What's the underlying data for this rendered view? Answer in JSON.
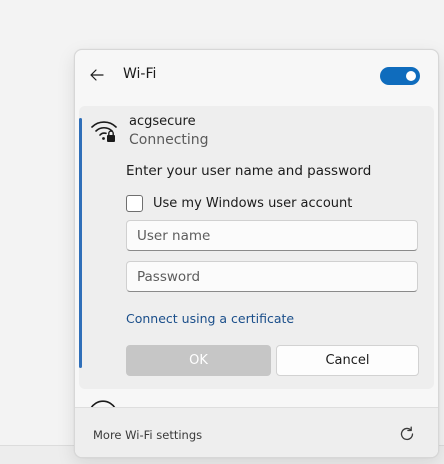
{
  "header": {
    "title": "Wi-Fi",
    "toggle_on": true
  },
  "network": {
    "name": "acgsecure",
    "status": "Connecting",
    "prompt": "Enter your user name and password",
    "use_windows_account_label": "Use my Windows user account",
    "use_windows_account_checked": false,
    "username_placeholder": "User name",
    "username_value": "",
    "password_placeholder": "Password",
    "password_value": "",
    "certificate_link": "Connect using a certificate",
    "ok_label": "OK",
    "cancel_label": "Cancel"
  },
  "footer": {
    "more_settings": "More Wi-Fi settings"
  },
  "icons": {
    "back": "back-arrow-icon",
    "wifi_secured": "wifi-lock-icon",
    "refresh": "refresh-icon"
  },
  "colors": {
    "accent": "#0f6cbd",
    "link": "#1a4e8a",
    "ok_disabled": "#c6c6c6"
  }
}
